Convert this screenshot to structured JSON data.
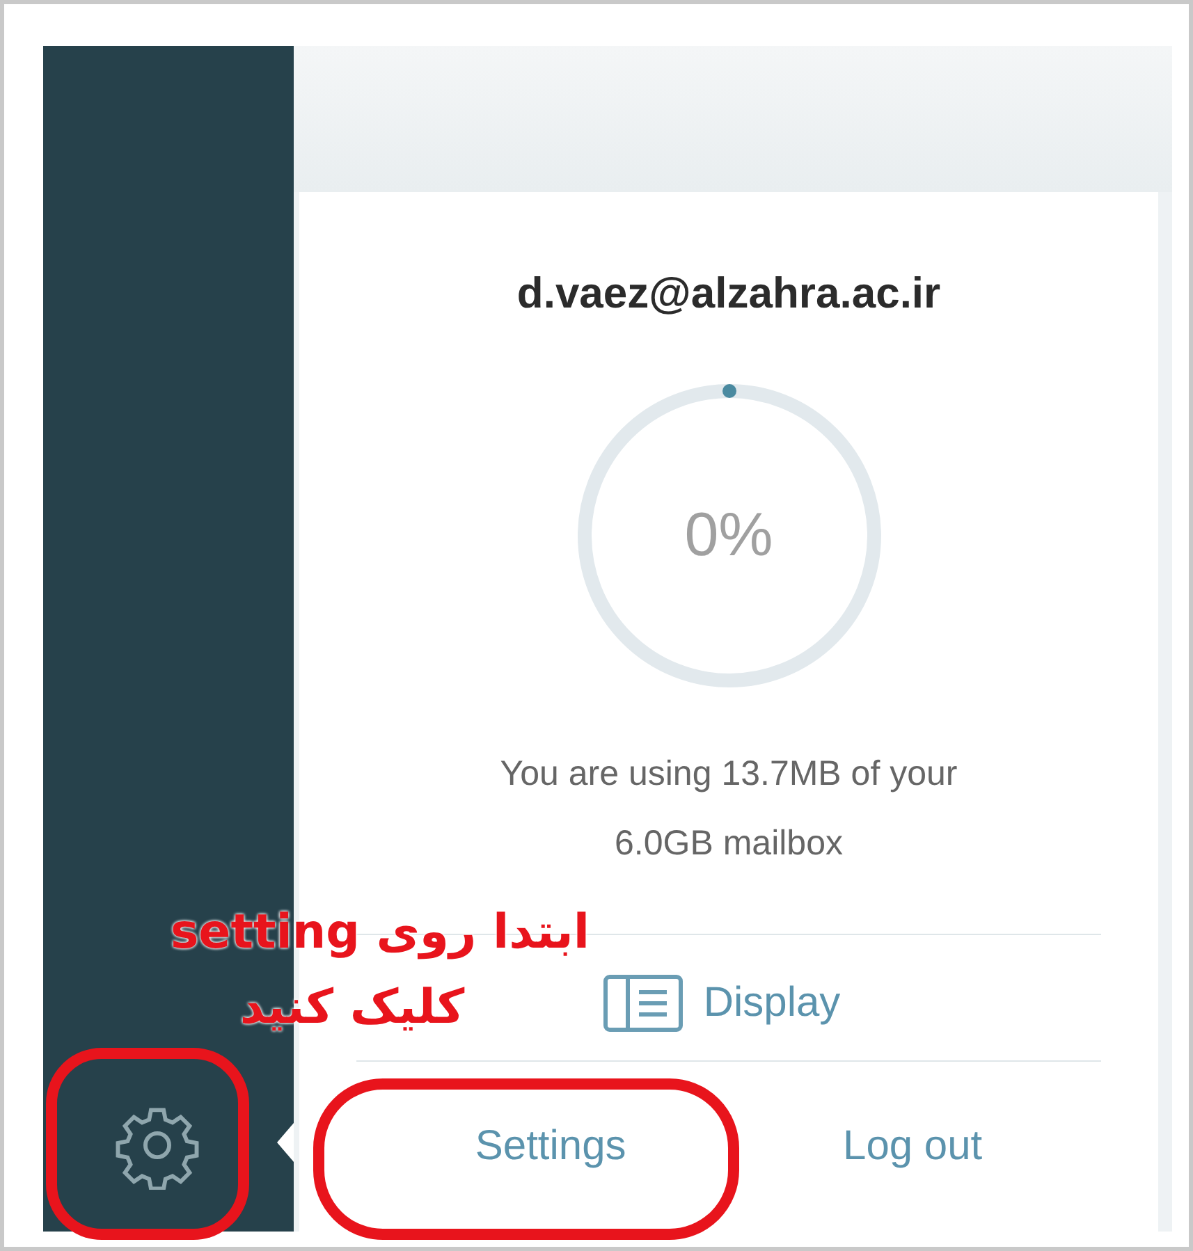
{
  "account": {
    "email": "d.vaez@alzahra.ac.ir"
  },
  "quota": {
    "level": 0,
    "percent": "0%",
    "usage": "You are using 13.7MB of your 6.0GB mailbox"
  },
  "menu": {
    "display": "Display",
    "settings": "Settings",
    "logout": "Log out"
  },
  "annotation": {
    "lines": [
      "ابتدا روی setting",
      "کلیک کنید"
    ]
  }
}
